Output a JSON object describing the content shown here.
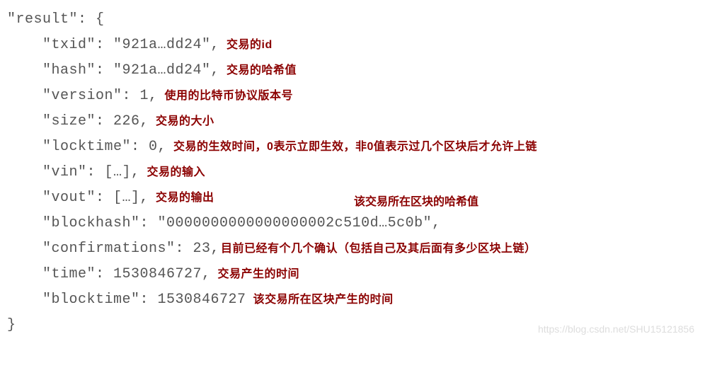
{
  "lines": {
    "result_open": "\"result\": {",
    "txid": "    \"txid\": \"921a…dd24\",",
    "hash": "    \"hash\": \"921a…dd24\",",
    "version": "    \"version\": 1,",
    "size": "    \"size\": 226,",
    "locktime": "    \"locktime\": 0,",
    "vin": "    \"vin\": […],",
    "vout": "    \"vout\": […],",
    "blockhash": "    \"blockhash\": \"0000000000000000002c510d…5c0b\",",
    "confirmations": "    \"confirmations\": 23,",
    "time": "    \"time\": 1530846727,",
    "blocktime": "    \"blocktime\": 1530846727",
    "result_close": "}"
  },
  "annotations": {
    "txid": "交易的id",
    "hash": "交易的哈希值",
    "version": "使用的比特币协议版本号",
    "size": "交易的大小",
    "locktime": "交易的生效时间，0表示立即生效，非0值表示过几个区块后才允许上链",
    "vin": "交易的输入",
    "vout": "交易的输出",
    "blockhash": "该交易所在区块的哈希值",
    "confirmations": "目前已经有个几个确认（包括自己及其后面有多少区块上链）",
    "time": "交易产生的时间",
    "blocktime": "该交易所在区块产生的时间"
  },
  "watermark": "https://blog.csdn.net/SHU15121856"
}
